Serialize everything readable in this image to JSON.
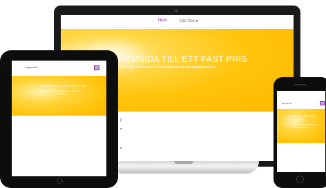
{
  "laptop": {
    "nav": {
      "home_label": "Hem",
      "about_label": "Om Oss ▾"
    },
    "hero": {
      "title": "HEMSIDA TILL ETT FAST PRIS",
      "subtitle": "En mogg mobilanpassad hemsida med ett fast uppdaterat pris."
    },
    "content": {
      "partial_glyph": "r"
    }
  },
  "tablet": {
    "nav": {
      "logo_text": "hdg.se.info"
    },
    "hero": {
      "title": "HEMSIDA TILL ETT FAST PRIS",
      "subtitle": "En mogg mobilanpassad hemsida med ett fast uppdaterat pris."
    }
  },
  "phone": {
    "nav": {
      "logo_text": "hdg.se.info"
    },
    "hero": {
      "title": "HEMSIDA TILL ETT FAST PRIS",
      "subtitle": "En mogg mobilanpassad hemsida med ett fast uppdaterat pris."
    }
  },
  "colors": {
    "hero_yellow": "#ffc40a",
    "nav_active": "#8e24aa",
    "device_black": "#0d0d0d"
  }
}
